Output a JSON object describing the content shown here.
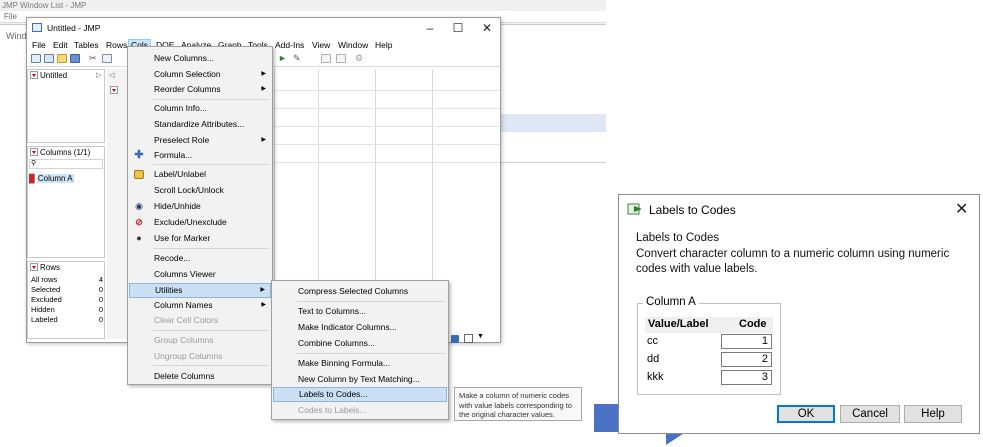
{
  "background_window": {
    "title": "JMP Window List - JMP",
    "menus": [
      "File",
      "Tables",
      "DOE",
      "Analyze",
      "Graph",
      "Tools",
      "Add-Ins",
      "View",
      "Window",
      "Help"
    ],
    "side_label": "Wind"
  },
  "data_table_window": {
    "title": "Untitled - JMP",
    "menus": [
      "File",
      "Edit",
      "Tables",
      "Rows",
      "Cols",
      "DOE",
      "Analyze",
      "Graph",
      "Tools",
      "Add-Ins",
      "View",
      "Window",
      "Help"
    ],
    "selected_menu": "Cols",
    "table_panel_title": "Untitled",
    "columns_panel_title": "Columns (1/1)",
    "column_name": "Column A",
    "rows_panel_title": "Rows",
    "row_stats": [
      {
        "label": "All rows",
        "value": "4"
      },
      {
        "label": "Selected",
        "value": "0"
      },
      {
        "label": "Excluded",
        "value": "0"
      },
      {
        "label": "Hidden",
        "value": "0"
      },
      {
        "label": "Labeled",
        "value": "0"
      }
    ]
  },
  "cols_menu": {
    "items": [
      {
        "label": "New Columns...",
        "submenu": false,
        "enabled": true,
        "icon": ""
      },
      {
        "label": "Column Selection",
        "submenu": true,
        "enabled": true,
        "icon": ""
      },
      {
        "label": "Reorder Columns",
        "submenu": true,
        "enabled": true,
        "icon": ""
      },
      {
        "label": "Column Info...",
        "submenu": false,
        "enabled": true,
        "icon": ""
      },
      {
        "label": "Standardize Attributes...",
        "submenu": false,
        "enabled": true,
        "icon": ""
      },
      {
        "label": "Preselect Role",
        "submenu": true,
        "enabled": true,
        "icon": ""
      },
      {
        "label": "Formula...",
        "submenu": false,
        "enabled": true,
        "icon": "plus-icon"
      },
      {
        "label": "Label/Unlabel",
        "submenu": false,
        "enabled": true,
        "icon": "label-icon"
      },
      {
        "label": "Scroll Lock/Unlock",
        "submenu": false,
        "enabled": true,
        "icon": ""
      },
      {
        "label": "Hide/Unhide",
        "submenu": false,
        "enabled": true,
        "icon": "hide-icon"
      },
      {
        "label": "Exclude/Unexclude",
        "submenu": false,
        "enabled": true,
        "icon": "exclude-icon"
      },
      {
        "label": "Use for Marker",
        "submenu": false,
        "enabled": true,
        "icon": "marker-icon"
      },
      {
        "label": "Recode...",
        "submenu": false,
        "enabled": true,
        "icon": ""
      },
      {
        "label": "Columns Viewer",
        "submenu": false,
        "enabled": true,
        "icon": ""
      },
      {
        "label": "Utilities",
        "submenu": true,
        "enabled": true,
        "icon": ""
      },
      {
        "label": "Column Names",
        "submenu": true,
        "enabled": true,
        "icon": ""
      },
      {
        "label": "Clear Cell Colors",
        "submenu": false,
        "enabled": false,
        "icon": ""
      },
      {
        "label": "Group Columns",
        "submenu": false,
        "enabled": false,
        "icon": ""
      },
      {
        "label": "Ungroup Columns",
        "submenu": false,
        "enabled": false,
        "icon": ""
      },
      {
        "label": "Delete Columns",
        "submenu": false,
        "enabled": true,
        "icon": ""
      }
    ],
    "highlighted": "Utilities"
  },
  "utilities_submenu": {
    "items": [
      {
        "label": "Compress Selected Columns",
        "enabled": true
      },
      {
        "label": "Text to Columns...",
        "enabled": true
      },
      {
        "label": "Make Indicator Columns...",
        "enabled": true
      },
      {
        "label": "Combine Columns...",
        "enabled": true
      },
      {
        "label": "Make Binning Formula...",
        "enabled": true
      },
      {
        "label": "New Column by Text Matching...",
        "enabled": true
      },
      {
        "label": "Labels to Codes...",
        "enabled": true
      },
      {
        "label": "Codes to Labels...",
        "enabled": false
      }
    ],
    "highlighted": "Labels to Codes..."
  },
  "tooltip": {
    "text": "Make a column of numeric codes with value labels corresponding to the original character values."
  },
  "dialog": {
    "title": "Labels to Codes",
    "heading": "Labels to Codes",
    "description": "Convert character column to a numeric column using numeric codes with value labels.",
    "group_label": "Column A",
    "table_headers": {
      "label": "Value/Label",
      "code": "Code"
    },
    "rows": [
      {
        "label": "cc",
        "code": "1"
      },
      {
        "label": "dd",
        "code": "2"
      },
      {
        "label": "kkk",
        "code": "3"
      }
    ],
    "buttons": {
      "ok": "OK",
      "cancel": "Cancel",
      "help": "Help"
    }
  },
  "colors": {
    "highlight": "#c8dff4",
    "arrow": "#4a72c4",
    "red_marker": "#d00000",
    "accent_blue": "#0078d7"
  }
}
